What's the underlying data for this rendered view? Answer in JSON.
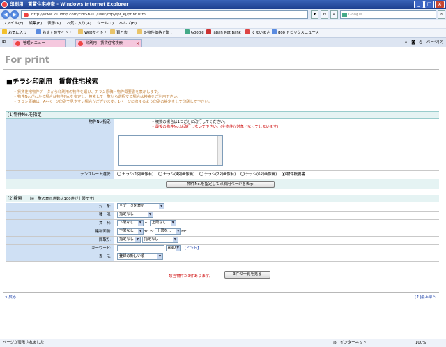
{
  "window": {
    "title": "印刷用　賃貸住宅検索 - Windows Internet Explorer"
  },
  "address": {
    "url": "http://www.2108hp.com/FH/SB-01/user/ropy/pr_kj/print.html"
  },
  "search": {
    "placeholder": "Google"
  },
  "menu": [
    "ファイル(F)",
    "編集(E)",
    "表示(V)",
    "お気に入り(A)",
    "ツール(T)",
    "ヘルプ(H)"
  ],
  "favorites": {
    "label": "お気に入り",
    "items": [
      "おすすめサイト・",
      "Webサイト・",
      "百万表",
      "e-物件価格で建て",
      "Google",
      "Japan Net Bank",
      "すまいまさ",
      "goo トピックスニュース"
    ]
  },
  "tabs": [
    {
      "label": "管理メニュー"
    },
    {
      "label": "印刷用　賃貸住宅検索"
    }
  ],
  "tab_tools": [
    "ページ(P)"
  ],
  "page": {
    "heading": "For print",
    "title": "■チラシ印刷用　賃貸住宅検索",
    "notes": [
      "賃貸住宅物件データから印刷用の物件を選び、チラシ原稿・物件概要書を表示します。",
      "物件No.がわかる場合は物件No.を指定し、検索して一覧から選択する場合は検索をご利用下さい。",
      "チラシ原稿は、A4ページ印刷で見やすい場合がございます。1ページに収まるよう印刷の設定をして印刷して下さい。"
    ]
  },
  "section1": {
    "header": "[1]物件No.を指定",
    "field_label": "物件No.指定:",
    "instr1": "複数の場合は1つごとに改行してください。",
    "instr2": "最後の物件No.は改行しないで下さい。(全物件が対象となってしまいます)",
    "template_label": "テンプレート選択:",
    "templates": [
      {
        "label": "チラシ(1列画像有)",
        "checked": false
      },
      {
        "label": "チラシ(4列画像無)",
        "checked": false
      },
      {
        "label": "チラシ(2列画像有)",
        "checked": false
      },
      {
        "label": "チラシ(6列画像無)",
        "checked": false
      },
      {
        "label": "物件概要書",
        "checked": true
      }
    ],
    "submit": "物件No.を指定して印刷用ページを表示"
  },
  "section2": {
    "header": "[2]検索",
    "header_note": "（※一覧の表示件数は100件が上限です）",
    "rows": [
      {
        "label": "対　象:",
        "select": "全データを表示"
      },
      {
        "label": "種　別:",
        "select": "指定なし"
      },
      {
        "label": "賃　料:",
        "select_min": "下限なし",
        "sep": "〜",
        "select_max": "上限なし"
      },
      {
        "label": "建物面積:",
        "select_min": "下限なし",
        "unit_min": "m²",
        "sep": "〜",
        "select_max": "上限なし",
        "unit_max": "m²"
      },
      {
        "label": "間取り:",
        "select_a": "指定なし",
        "select_b": "指定なし"
      },
      {
        "label": "キーワード:",
        "select": "AND",
        "hint": "【ヒント】"
      },
      {
        "label": "表　示:",
        "select": "登録の新しい順"
      }
    ],
    "result_text": "該当物件が3件あります。",
    "list_button": "3件の一覧を見る"
  },
  "footer": {
    "back": "< 戻る",
    "top": "[↑]最上部へ"
  },
  "status": {
    "text": "ページが表示されました",
    "zone": "インターネット",
    "zoom": "100%"
  }
}
